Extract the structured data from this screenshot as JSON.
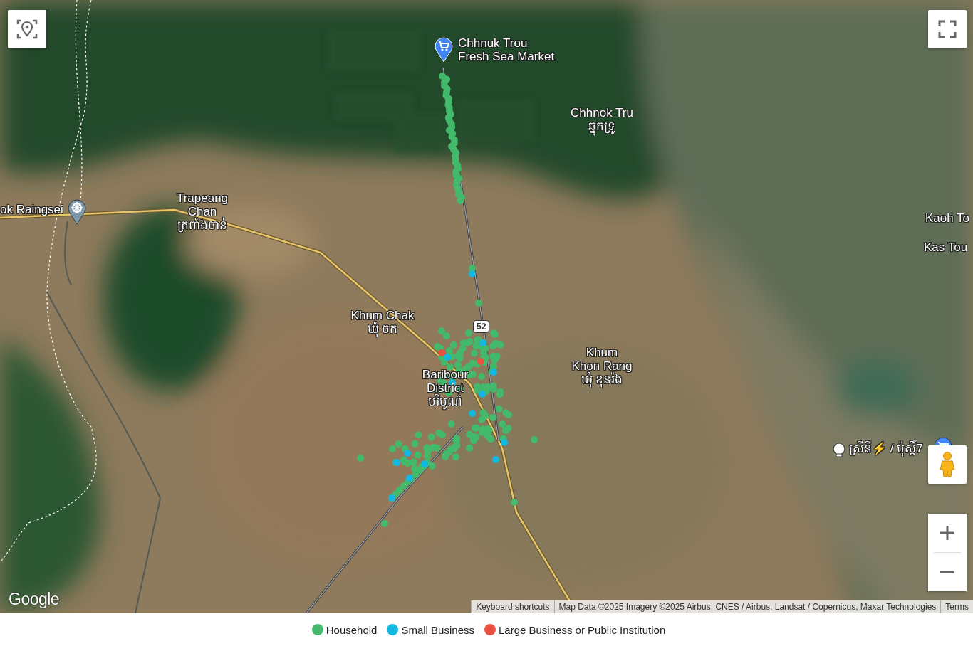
{
  "map_labels": [
    {
      "lines": [
        "Chhnuk Trou",
        "Fresh Sea Market"
      ]
    },
    {
      "lines": [
        "Chhnok Tru",
        "ឆ្នុកទ្រូ"
      ]
    },
    {
      "lines": [
        "ok Raingsei"
      ]
    },
    {
      "lines": [
        "Trapeang",
        "Chan",
        "ត្រពាំងចាន់"
      ]
    },
    {
      "lines": [
        "Kaoh To"
      ]
    },
    {
      "lines": [
        "Kas Tou"
      ]
    },
    {
      "lines": [
        "Khum Chak",
        "ឃុំ ចក"
      ]
    },
    {
      "lines": [
        "Baribour",
        "District",
        "បរិបូណ៌"
      ]
    },
    {
      "lines": [
        "Khum",
        "Khon Rang",
        "ឃុំ ខុនរ៉ង"
      ]
    },
    {
      "lines": [
        "ស្រីនី⚡ / ប៉ុស្តិ៍7"
      ]
    }
  ],
  "road_shield": "52",
  "logo": "Google",
  "attribution": [
    "Keyboard shortcuts",
    "Map Data ©2025 Imagery ©2025 Airbus, CNES / Airbus, Landsat / Copernicus, Maxar Technologies",
    "Terms"
  ],
  "legend": [
    {
      "label": "Household",
      "color": "#43b96b"
    },
    {
      "label": "Small Business",
      "color": "#12b8e0"
    },
    {
      "label": "Large Business or Public Institution",
      "color": "#ea4f3f"
    }
  ]
}
